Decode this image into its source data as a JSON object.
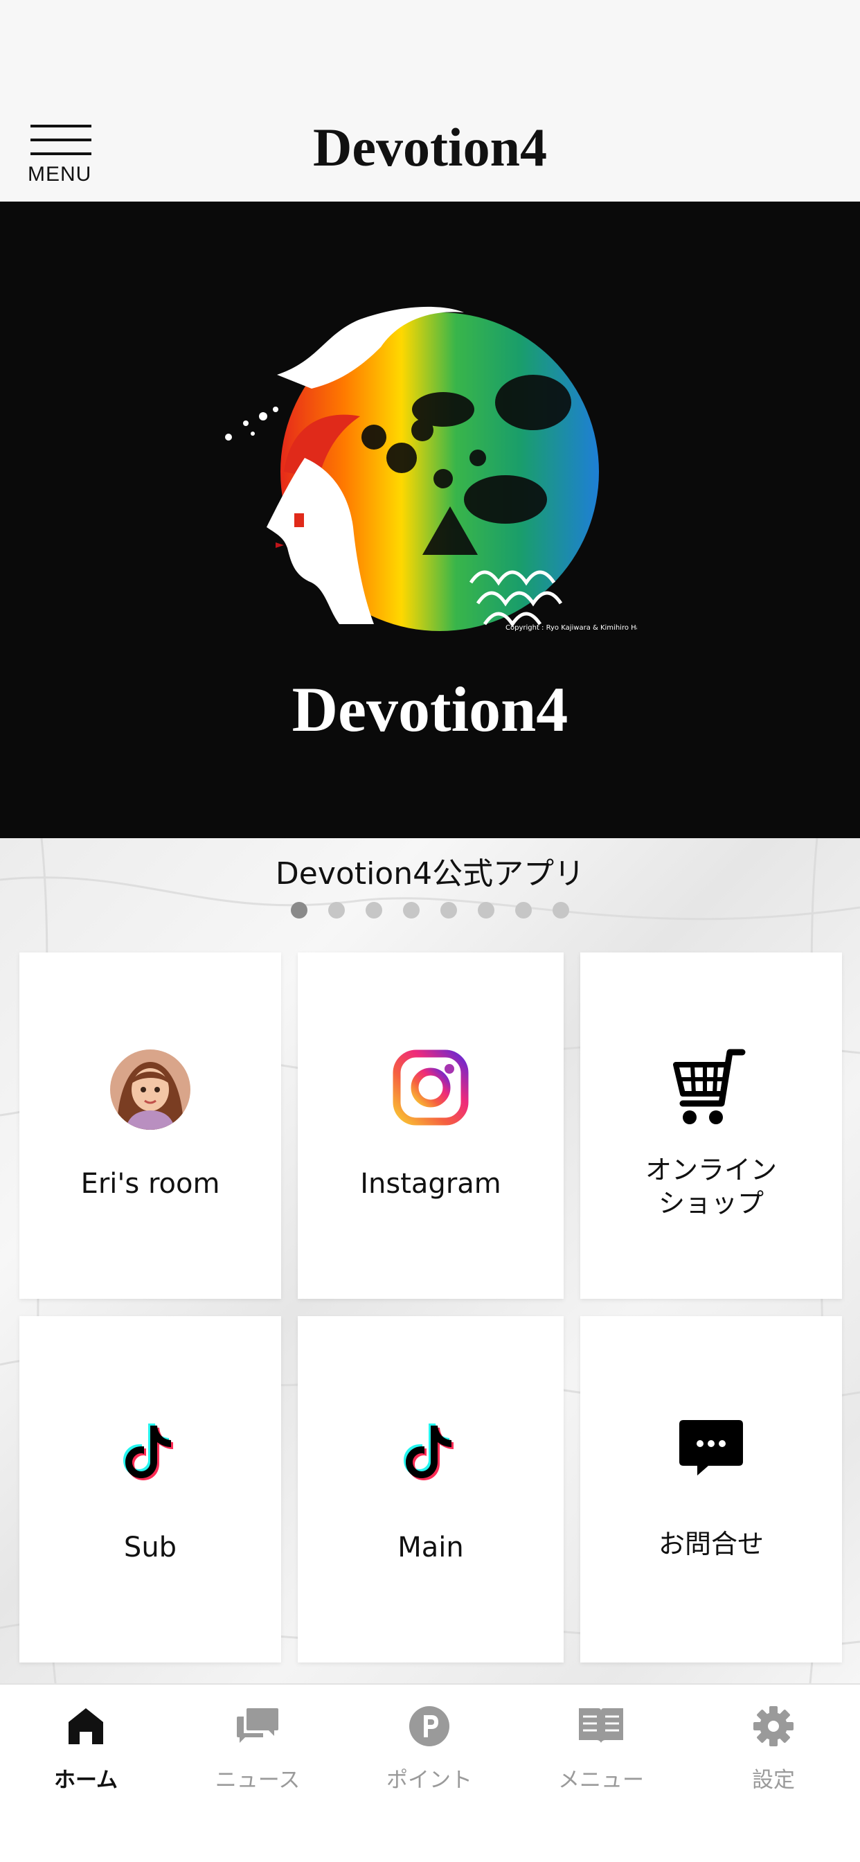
{
  "header": {
    "menu_label": "MENU",
    "title": "Devotion4"
  },
  "hero": {
    "brand": "Devotion4",
    "copyright": "Copyright : Ryo Kajiwara & Kimihiro Harauchi"
  },
  "carousel": {
    "title": "Devotion4公式アプリ",
    "page_count": 8,
    "active_index": 0
  },
  "tiles": [
    {
      "label": "Eri's room",
      "icon": "avatar-icon"
    },
    {
      "label": "Instagram",
      "icon": "instagram-icon"
    },
    {
      "label": "オンライン\nショップ",
      "line1": "オンライン",
      "line2": "ショップ",
      "icon": "shopping-cart-icon"
    },
    {
      "label": "Sub",
      "icon": "tiktok-icon"
    },
    {
      "label": "Main",
      "icon": "tiktok-icon"
    },
    {
      "label": "お問合せ",
      "icon": "chat-bubble-icon"
    }
  ],
  "tabbar": {
    "items": [
      {
        "label": "ホーム",
        "icon": "home-icon",
        "active": true
      },
      {
        "label": "ニュース",
        "icon": "news-icon",
        "active": false
      },
      {
        "label": "ポイント",
        "icon": "point-icon",
        "active": false
      },
      {
        "label": "メニュー",
        "icon": "menu-book-icon",
        "active": false
      },
      {
        "label": "設定",
        "icon": "gear-icon",
        "active": false
      }
    ]
  },
  "colors": {
    "hero_bg": "#0a0a0a",
    "tab_active": "#111111",
    "tab_inactive": "#9a9a9a",
    "instagram_gradient": [
      "#f9c932",
      "#ee2a7b",
      "#6228d7"
    ],
    "tiktok_cyan": "#25f4ee",
    "tiktok_red": "#fe2c55"
  }
}
